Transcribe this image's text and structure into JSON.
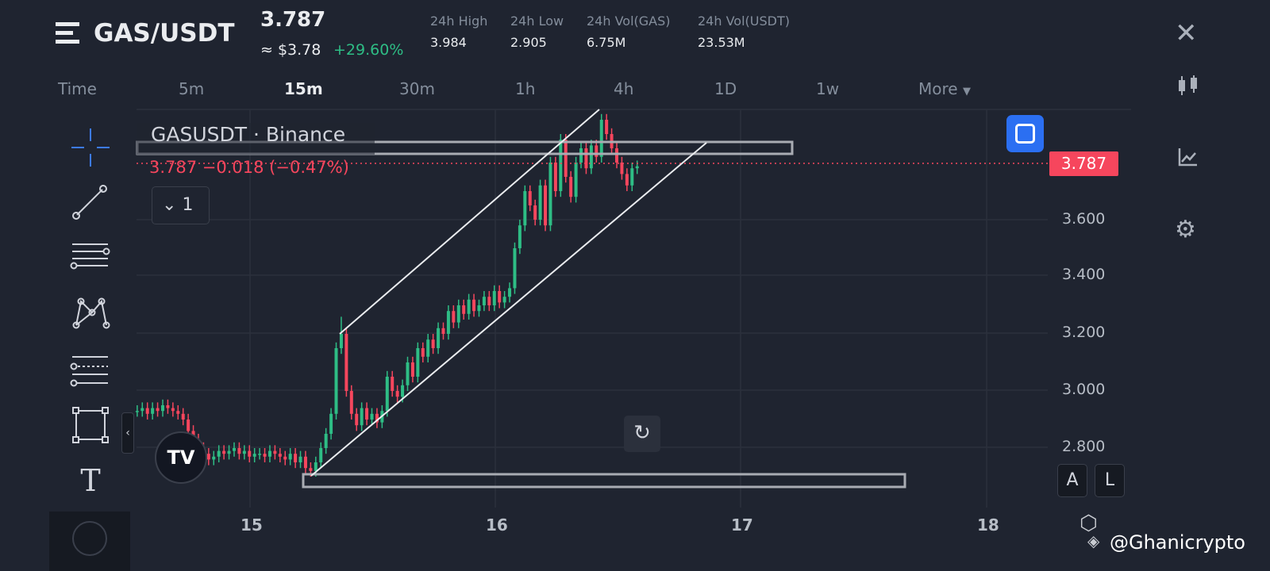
{
  "header": {
    "symbol": "GAS/USDT",
    "price": "3.787",
    "usd_price": "≈ $3.78",
    "change_pct": "+29.60%",
    "stats": [
      {
        "label": "24h High",
        "value": "3.984"
      },
      {
        "label": "24h Low",
        "value": "2.905"
      },
      {
        "label": "24h Vol(GAS)",
        "value": "6.75M"
      },
      {
        "label": "24h Vol(USDT)",
        "value": "23.53M"
      }
    ]
  },
  "timeframes": [
    "Time",
    "5m",
    "15m",
    "30m",
    "1h",
    "4h",
    "1D",
    "1w",
    "More"
  ],
  "active_timeframe": "15m",
  "legend": {
    "title": "GASUSDT · Binance",
    "values": "3.787  −0.018 (−0.47%)",
    "collapse_label": "1"
  },
  "price_label": "3.787",
  "scale_buttons": [
    "A",
    "L"
  ],
  "watermark": "@Ghanicrypto",
  "colors": {
    "up": "#2ebd85",
    "down": "#f6465d",
    "bg": "#1f2430"
  },
  "chart_data": {
    "type": "candlestick",
    "title": "GASUSDT · Binance",
    "interval_days": 0.0208,
    "start_day": 14.54,
    "x_ticks": [
      "15",
      "16",
      "17",
      "18"
    ],
    "y_ticks": [
      "3.600",
      "3.400",
      "3.200",
      "3.000",
      "2.800"
    ],
    "ylim": [
      2.7,
      4.0
    ],
    "xlim": [
      14.54,
      18.3
    ],
    "closes": [
      2.93,
      2.94,
      2.92,
      2.94,
      2.93,
      2.95,
      2.94,
      2.93,
      2.92,
      2.9,
      2.86,
      2.83,
      2.8,
      2.78,
      2.76,
      2.77,
      2.79,
      2.78,
      2.79,
      2.8,
      2.78,
      2.79,
      2.77,
      2.78,
      2.78,
      2.77,
      2.79,
      2.78,
      2.77,
      2.76,
      2.78,
      2.75,
      2.77,
      2.73,
      2.72,
      2.75,
      2.8,
      2.85,
      2.92,
      3.15,
      3.2,
      3.0,
      2.92,
      2.88,
      2.94,
      2.9,
      2.92,
      2.89,
      2.93,
      3.05,
      3.0,
      2.98,
      3.02,
      3.1,
      3.05,
      3.15,
      3.12,
      3.18,
      3.15,
      3.22,
      3.2,
      3.28,
      3.24,
      3.3,
      3.27,
      3.32,
      3.28,
      3.3,
      3.33,
      3.3,
      3.35,
      3.31,
      3.33,
      3.36,
      3.5,
      3.58,
      3.7,
      3.65,
      3.6,
      3.72,
      3.58,
      3.8,
      3.7,
      3.88,
      3.75,
      3.68,
      3.8,
      3.85,
      3.78,
      3.86,
      3.82,
      3.95,
      3.9,
      3.85,
      3.8,
      3.76,
      3.72,
      3.78,
      3.787
    ],
    "last_price": 3.787
  }
}
